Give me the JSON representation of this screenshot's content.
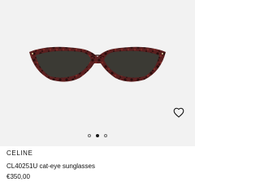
{
  "product": {
    "brand": "CELINE",
    "name": "CL40251U cat-eye sunglasses",
    "price": "€350,00"
  },
  "carousel": {
    "slides": 3,
    "active_index": 1
  },
  "icons": {
    "wishlist": "heart-outline-icon"
  },
  "colors": {
    "background": "#f2f2f2",
    "frame_tortoise": "#5a1f1f",
    "lens": "#3b3a34",
    "text": "#111111"
  }
}
